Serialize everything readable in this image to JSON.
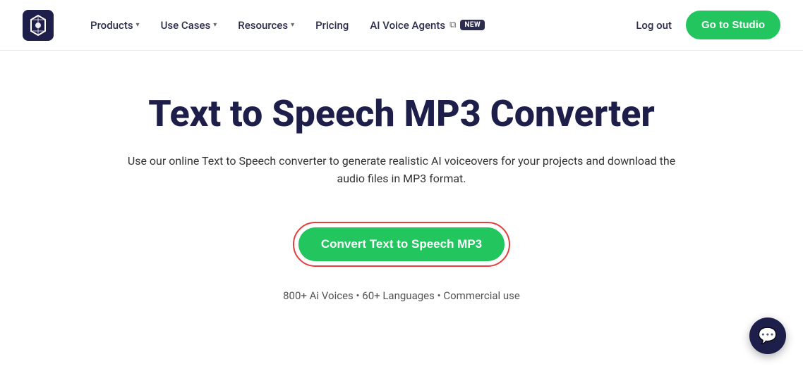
{
  "navbar": {
    "logo_alt": "PlayHT Logo",
    "nav_items": [
      {
        "label": "Products",
        "has_dropdown": true
      },
      {
        "label": "Use Cases",
        "has_dropdown": true
      },
      {
        "label": "Resources",
        "has_dropdown": true
      },
      {
        "label": "Pricing",
        "has_dropdown": false
      },
      {
        "label": "AI Voice Agents",
        "has_dropdown": false,
        "has_badge": true,
        "badge_text": "NEW",
        "has_ext_icon": true
      }
    ],
    "logout_label": "Log out",
    "goto_studio_label": "Go to Studio"
  },
  "hero": {
    "title": "Text to Speech MP3 Converter",
    "subtitle": "Use our online Text to Speech converter to generate realistic AI voiceovers for your projects and download the audio files in MP3 format.",
    "cta_label": "Convert Text to Speech MP3",
    "features": "800+ Ai Voices • 60+ Languages • Commercial use"
  },
  "chat": {
    "icon": "💬"
  }
}
